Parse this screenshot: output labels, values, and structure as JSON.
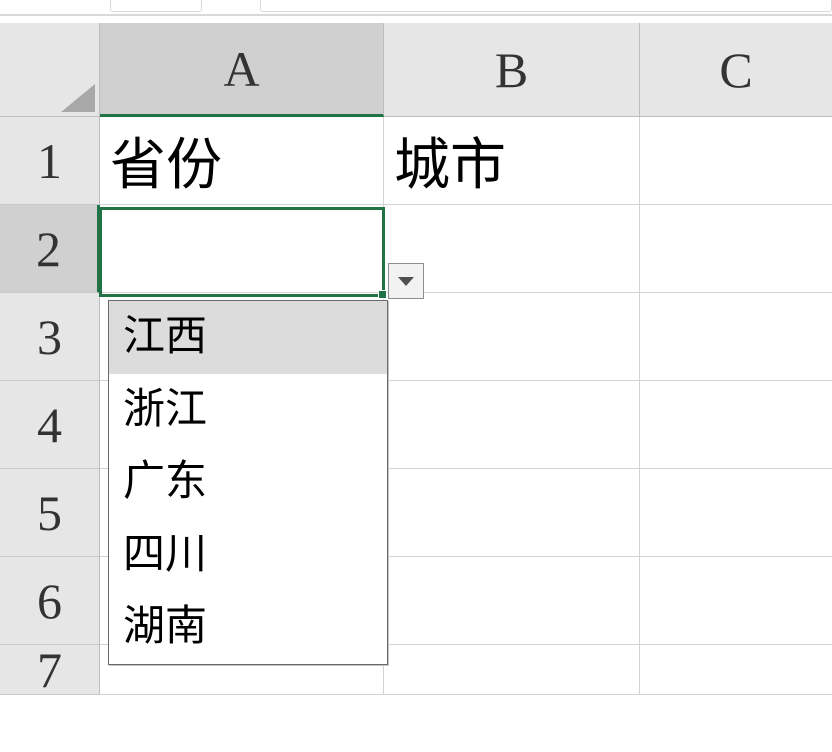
{
  "columns": {
    "A": "A",
    "B": "B",
    "C": "C"
  },
  "rows": {
    "r1": "1",
    "r2": "2",
    "r3": "3",
    "r4": "4",
    "r5": "5",
    "r6": "6",
    "r7": "7"
  },
  "cells": {
    "A1": "省份",
    "B1": "城市"
  },
  "dropdown": {
    "items": [
      "江西",
      "浙江",
      "广东",
      "四川",
      "湖南"
    ],
    "hover_index": 0
  },
  "selected_cell": "A2"
}
